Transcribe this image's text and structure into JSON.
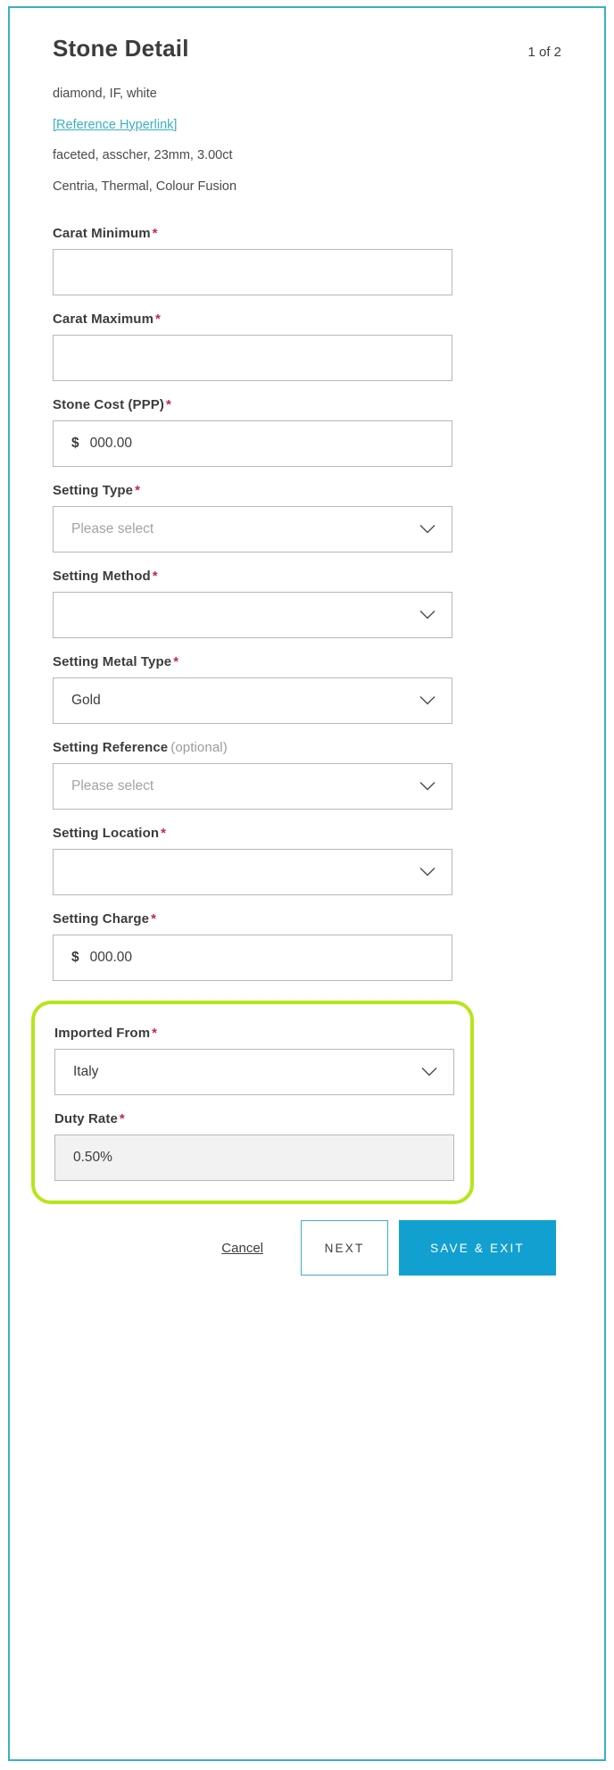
{
  "header": {
    "title": "Stone Detail",
    "counter": "1 of 2"
  },
  "summary": {
    "line1": "diamond, IF, white",
    "reference_link": "[Reference Hyperlink]",
    "line3": "faceted, asscher, 23mm, 3.00ct",
    "line4": "Centria, Thermal, Colour Fusion"
  },
  "fields": {
    "carat_minimum": {
      "label": "Carat Minimum",
      "required_marker": "*",
      "value": "",
      "placeholder": ""
    },
    "carat_maximum": {
      "label": "Carat Maximum",
      "required_marker": "*",
      "value": "",
      "placeholder": ""
    },
    "stone_cost": {
      "label": "Stone Cost (PPP)",
      "required_marker": "*",
      "currency": "$",
      "value": "000.00"
    },
    "setting_type": {
      "label": "Setting Type",
      "required_marker": "*",
      "value": "Please select"
    },
    "setting_method": {
      "label": "Setting Method",
      "required_marker": "*",
      "value": ""
    },
    "setting_metal_type": {
      "label": "Setting Metal Type",
      "required_marker": "*",
      "value": "Gold"
    },
    "setting_reference": {
      "label": "Setting Reference",
      "optional_marker": "(optional)",
      "value": "Please select"
    },
    "setting_location": {
      "label": "Setting Location",
      "required_marker": "*",
      "value": ""
    },
    "setting_charge": {
      "label": "Setting Charge",
      "required_marker": "*",
      "currency": "$",
      "value": "000.00"
    },
    "imported_from": {
      "label": "Imported From",
      "required_marker": "*",
      "value": "Italy"
    },
    "duty_rate": {
      "label": "Duty Rate",
      "required_marker": "*",
      "value": "0.50%"
    }
  },
  "footer": {
    "cancel_label": "Cancel",
    "next_label": "NEXT",
    "save_exit_label": "SAVE & EXIT"
  },
  "colors": {
    "frame_teal": "#3ab0c6",
    "link_teal": "#3ab0c6",
    "highlight_green": "#b5e619",
    "primary_blue": "#12a0d1",
    "required_red": "#c2284b",
    "readonly_gray": "#f2f2f2"
  }
}
